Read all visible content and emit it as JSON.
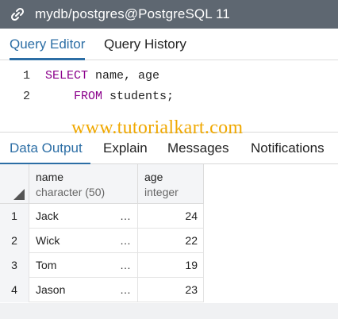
{
  "titlebar": {
    "title": "mydb/postgres@PostgreSQL 11",
    "icon": "connection-link-icon"
  },
  "editor_tabs": [
    {
      "label": "Query Editor",
      "active": true
    },
    {
      "label": "Query History",
      "active": false
    }
  ],
  "editor": {
    "lines": [
      {
        "number": "1",
        "parts": [
          {
            "text": "SELECT",
            "keyword": true
          },
          {
            "text": " name, age",
            "keyword": false
          }
        ]
      },
      {
        "number": "2",
        "parts": [
          {
            "text": "    ",
            "keyword": false
          },
          {
            "text": "FROM",
            "keyword": true
          },
          {
            "text": " students;",
            "keyword": false
          }
        ]
      }
    ],
    "keyword_color": "#8b008b"
  },
  "watermark": "www.tutorialkart.com",
  "output_tabs": [
    {
      "label": "Data Output",
      "active": true
    },
    {
      "label": "Explain",
      "active": false
    },
    {
      "label": "Messages",
      "active": false
    },
    {
      "label": "Notifications",
      "active": false
    }
  ],
  "grid": {
    "columns": [
      {
        "name": "name",
        "type": "character (50)"
      },
      {
        "name": "age",
        "type": "integer"
      }
    ],
    "rows": [
      {
        "num": "1",
        "name": "Jack",
        "age": "24"
      },
      {
        "num": "2",
        "name": "Wick",
        "age": "22"
      },
      {
        "num": "3",
        "name": "Tom",
        "age": "19"
      },
      {
        "num": "4",
        "name": "Jason",
        "age": "23"
      }
    ],
    "truncation_marker": "…"
  },
  "colors": {
    "titlebar_bg": "#5e6771",
    "accent": "#2c6ea5",
    "watermark": "#f0a800"
  }
}
